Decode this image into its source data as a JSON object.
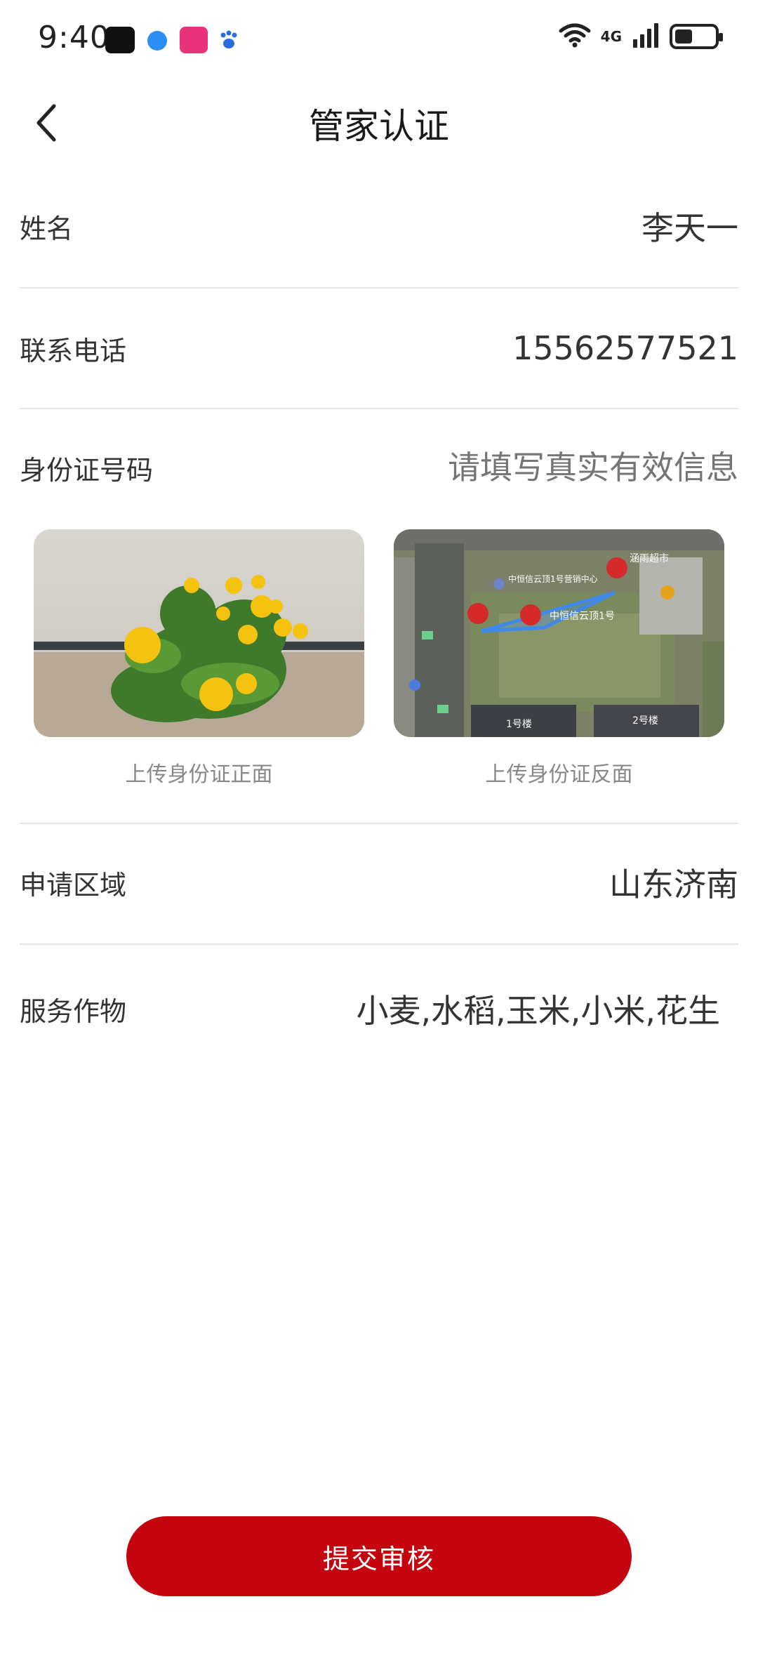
{
  "status_bar": {
    "time": "9:40",
    "network": "4G"
  },
  "header": {
    "title": "管家认证"
  },
  "form": {
    "name": {
      "label": "姓名",
      "value": "李天一"
    },
    "phone": {
      "label": "联系电话",
      "value": "15562577521"
    },
    "id_number": {
      "label": "身份证号码",
      "placeholder": "请填写真实有效信息"
    },
    "uploads": {
      "front_caption": "上传身份证正面",
      "back_caption": "上传身份证反面",
      "map_labels": {
        "store": "涵雨超市",
        "sales_center": "中恒信云顶1号营销中心",
        "site": "中恒信云顶1号",
        "building1": "1号楼",
        "building2": "2号楼"
      }
    },
    "region": {
      "label": "申请区域",
      "value": "山东济南"
    },
    "crops": {
      "label": "服务作物",
      "value": "小麦,水稻,玉米,小米,花生"
    }
  },
  "submit": {
    "label": "提交审核"
  },
  "colors": {
    "accent": "#c4040f",
    "divider": "#e5e5e5",
    "placeholder": "#bdbdbd",
    "caption": "#888888"
  }
}
